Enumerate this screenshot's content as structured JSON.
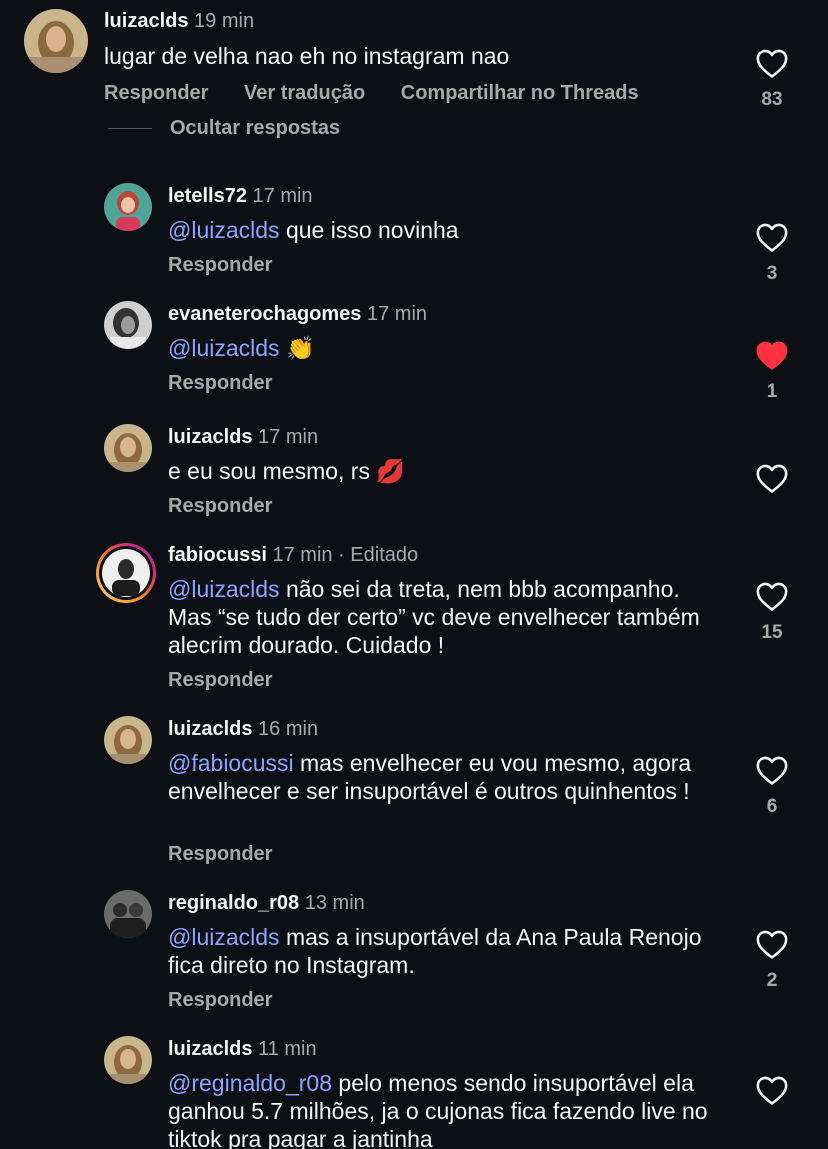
{
  "top_comment": {
    "user": "luizaclds",
    "time": "19 min",
    "text": "lugar de velha nao eh no instagram nao",
    "actions": {
      "reply": "Responder",
      "translate": "Ver tradução",
      "share": "Compartilhar no Threads"
    },
    "likes": "83"
  },
  "hide_replies_label": "Ocultar respostas",
  "replies": [
    {
      "user": "letells72",
      "time": "17 min",
      "mention": "@luizaclds",
      "text": " que isso novinha",
      "reply": "Responder",
      "likes": "3",
      "liked": false
    },
    {
      "user": "evaneterochagomes",
      "time": "17 min",
      "mention": "@luizaclds",
      "text": " 👏",
      "reply": "Responder",
      "likes": "1",
      "liked": true
    },
    {
      "user": "luizaclds",
      "time": "17 min",
      "mention": "",
      "text": "e eu sou mesmo, rs 💋",
      "reply": "Responder",
      "likes": "",
      "liked": false
    },
    {
      "user": "fabiocussi",
      "time": "17 min",
      "edited": " · Editado",
      "mention": "@luizaclds",
      "text": " não sei da treta, nem bbb acompanho. Mas “se tudo der certo” vc deve envelhecer também alecrim dourado. Cuidado !",
      "reply": "Responder",
      "likes": "15",
      "liked": false
    },
    {
      "user": "luizaclds",
      "time": "16 min",
      "mention": "@fabiocussi",
      "text": " mas envelhecer eu vou mesmo, agora envelhecer e ser insuportável é outros quinhentos !",
      "reply": "Responder",
      "likes": "6",
      "liked": false
    },
    {
      "user": "reginaldo_r08",
      "time": "13 min",
      "mention": "@luizaclds",
      "text": " mas a insuportável da Ana Paula Renojo fica direto no Instagram.",
      "reply": "Responder",
      "likes": "2",
      "liked": false
    },
    {
      "user": "luizaclds",
      "time": "11 min",
      "mention": "@reginaldo_r08",
      "text": " pelo menos sendo insuportável ela ganhou 5.7 milhões, ja o cujonas fica fazendo live no tiktok pra pagar a jantinha",
      "reply": "",
      "likes": "",
      "liked": false
    }
  ],
  "icons": {
    "heart": "heart-icon",
    "heart_filled": "heart-filled-icon"
  },
  "colors": {
    "background": "#0c1014",
    "mention": "#8aa4ff",
    "liked": "#ff3040",
    "muted": "#a8a8a8"
  }
}
